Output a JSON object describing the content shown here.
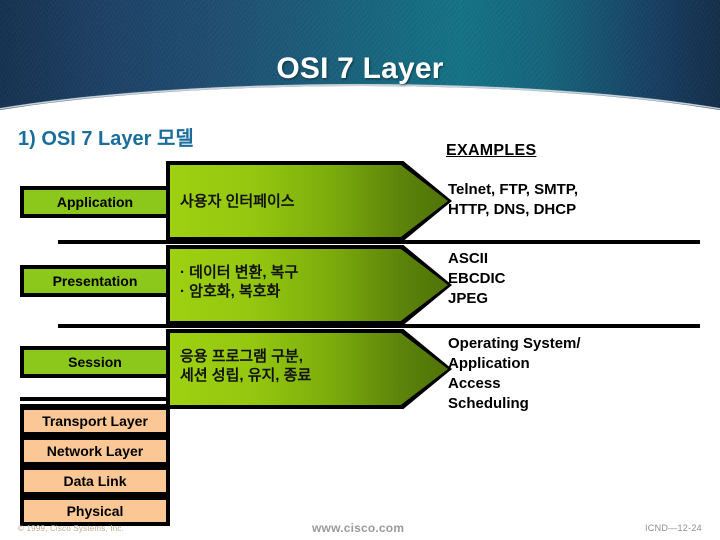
{
  "slide": {
    "title": "OSI 7 Layer",
    "subtitle": "1)  OSI 7 Layer 모델",
    "examples_heading": "EXAMPLES"
  },
  "colors": {
    "banner_dark_navy": "#1b3f63",
    "banner_teal": "#127286",
    "subtitle_blue": "#1b6e9c",
    "layer_green": "#8cc81b",
    "band_green_light": "#9ed111",
    "band_green_dark": "#4f7207",
    "layer_peach": "#fbc795",
    "outline_black": "#000000",
    "footer_gray": "#9a9a9a"
  },
  "layers": [
    {
      "name": "Application",
      "style": "green",
      "description": "사용자 인터페이스",
      "examples": "Telnet, FTP, SMTP,\nHTTP, DNS, DHCP"
    },
    {
      "name": "Presentation",
      "style": "green",
      "description": "· 데이터 변환, 복구\n· 암호화, 복호화",
      "examples": "ASCII\nEBCDIC\nJPEG"
    },
    {
      "name": "Session",
      "style": "green",
      "description": "응용 프로그램 구분,\n세션 성립, 유지, 종료",
      "examples": "Operating System/\nApplication\nAccess\nScheduling"
    },
    {
      "name": "Transport Layer",
      "style": "peach",
      "description": "",
      "examples": ""
    },
    {
      "name": "Network Layer",
      "style": "peach",
      "description": "",
      "examples": ""
    },
    {
      "name": "Data Link",
      "style": "peach",
      "description": "",
      "examples": ""
    },
    {
      "name": "Physical",
      "style": "peach",
      "description": "",
      "examples": ""
    }
  ],
  "footer": {
    "copyright": "© 1999, Cisco Systems, Inc.",
    "url": "www.cisco.com",
    "code": "ICND—12-24"
  }
}
